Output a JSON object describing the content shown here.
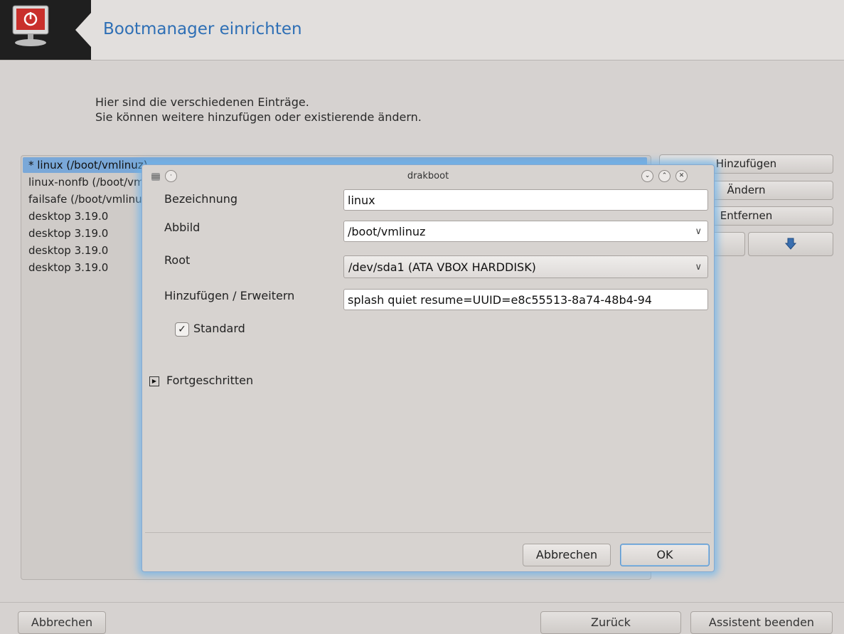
{
  "header": {
    "title": "Bootmanager einrichten",
    "icon": "power-monitor-icon"
  },
  "intro": {
    "line1": "Hier sind die verschiedenen Einträge.",
    "line2": "Sie können weitere hinzufügen oder existierende ändern."
  },
  "entries": [
    "* linux (/boot/vmlinuz)",
    "linux-nonfb (/boot/vmlinuz)",
    "failsafe (/boot/vmlinuz)",
    "desktop 3.19.0",
    "desktop 3.19.0",
    "desktop 3.19.0",
    "desktop 3.19.0"
  ],
  "side_buttons": {
    "add": "Hinzufügen",
    "modify": "Ändern",
    "remove": "Entfernen",
    "move_up": "",
    "move_down": "down-arrow-icon"
  },
  "footer": {
    "cancel": "Abbrechen",
    "back": "Zurück",
    "finish": "Assistent beenden"
  },
  "dialog": {
    "title": "drakboot",
    "label_label": "Bezeichnung",
    "label_value": "linux",
    "image_label": "Abbild",
    "image_value": "/boot/vmlinuz",
    "root_label": "Root",
    "root_value": "/dev/sda1 (ATA VBOX HARDDISK)",
    "append_label": "Hinzufügen / Erweitern",
    "append_value": "splash quiet resume=UUID=e8c55513-8a74-48b4-94",
    "default_label": "Standard",
    "default_checked": true,
    "advanced_label": "Fortgeschritten",
    "cancel": "Abbrechen",
    "ok": "OK"
  },
  "colors": {
    "accent": "#2e6fb5",
    "selection": "#7aa8d8",
    "glow": "#6eb4eb"
  }
}
